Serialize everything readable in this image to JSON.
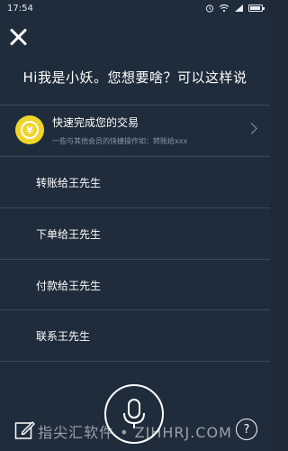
{
  "status_bar": {
    "time": "17:54",
    "icons": [
      "alarm-icon",
      "wifi-icon",
      "signal-icon",
      "battery-icon"
    ]
  },
  "greeting": "Hi我是小妖。您想要啥？可以这样说",
  "quick_card": {
    "title": "快速完成您的交易",
    "subtitle": "一些与其他会员的快捷操作如：转账给xxx",
    "icon": "coin-icon",
    "icon_symbol": "¥",
    "accent_color": "#f0d42a"
  },
  "commands": [
    {
      "label": "转账给王先生"
    },
    {
      "label": "下单给王先生"
    },
    {
      "label": "付款给王先生"
    },
    {
      "label": "联系王先生"
    }
  ],
  "bottom_bar": {
    "help_symbol": "?",
    "icons": [
      "edit-icon",
      "microphone-icon",
      "help-icon"
    ]
  },
  "watermark": "指尖汇软件 • ZJHHRJ.COM",
  "colors": {
    "background": "#1f2c3b",
    "divider": "#3a4756",
    "text": "#ffffff",
    "muted": "#8a96a6"
  }
}
